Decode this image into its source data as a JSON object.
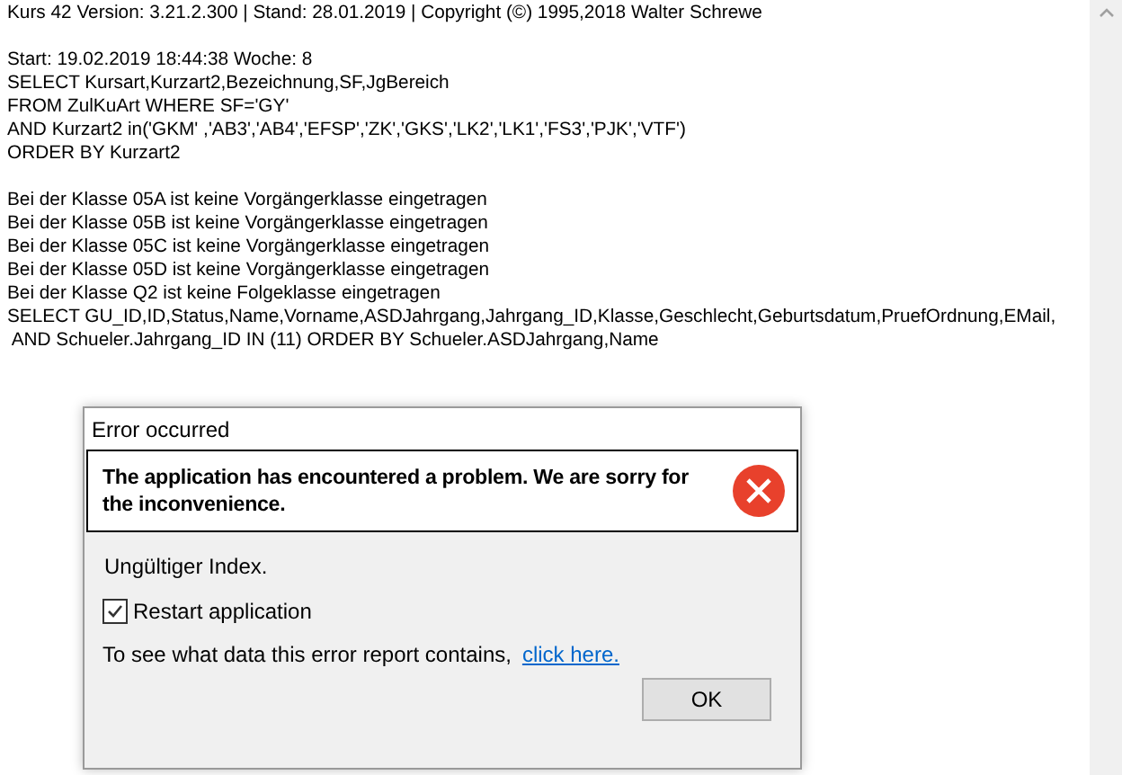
{
  "log": {
    "blocks": [
      [
        "Kurs 42 Version: 3.21.2.300 | Stand: 28.01.2019 | Copyright (©) 1995,2018 Walter Schrewe"
      ],
      [
        "Start: 19.02.2019 18:44:38 Woche: 8",
        "SELECT Kursart,Kurzart2,Bezeichnung,SF,JgBereich",
        "FROM ZulKuArt WHERE SF='GY'",
        "AND Kurzart2 in('GKM' ,'AB3','AB4','EFSP','ZK','GKS','LK2','LK1','FS3','PJK','VTF')",
        "ORDER BY Kurzart2"
      ],
      [
        "Bei der Klasse 05A ist keine Vorgängerklasse eingetragen",
        "Bei der Klasse 05B ist keine Vorgängerklasse eingetragen",
        "Bei der Klasse 05C ist keine Vorgängerklasse eingetragen",
        "Bei der Klasse 05D ist keine Vorgängerklasse eingetragen",
        "Bei der Klasse Q2 ist keine Folgeklasse eingetragen",
        "SELECT GU_ID,ID,Status,Name,Vorname,ASDJahrgang,Jahrgang_ID,Klasse,Geschlecht,Geburtsdatum,PruefOrdnung,EMail,",
        " AND Schueler.Jahrgang_ID IN (11) ORDER BY Schueler.ASDJahrgang,Name"
      ]
    ]
  },
  "dialog": {
    "title": "Error occurred",
    "headline": "The application has encountered a problem. We are sorry for the inconvenience.",
    "message": "Ungültiger Index.",
    "restart": {
      "label": "Restart application",
      "checked": true
    },
    "details_text": "To see what data this error report contains,",
    "details_link": "click here.",
    "buttons": [
      "OK"
    ]
  }
}
